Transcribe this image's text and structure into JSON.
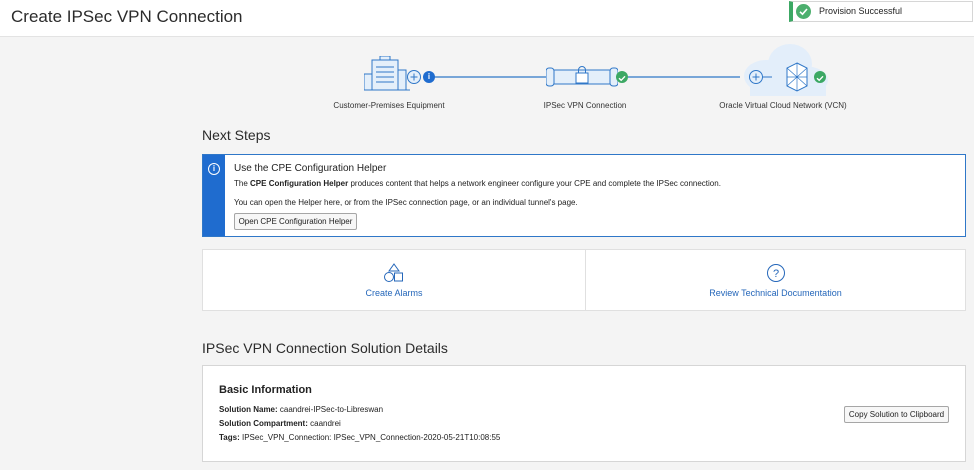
{
  "header": {
    "title": "Create IPSec VPN Connection"
  },
  "toast": {
    "message": "Provision Successful",
    "status_color": "#3ca864"
  },
  "diagram": {
    "steps": [
      {
        "label": "Customer-Premises Equipment",
        "status": "info",
        "status_color": "#1f6ccf",
        "icon": "building-icon"
      },
      {
        "label": "IPSec VPN Connection",
        "status": "success",
        "status_color": "#3ca864",
        "icon": "vpn-tunnel-icon"
      },
      {
        "label": "Oracle Virtual Cloud Network (VCN)",
        "status": "success",
        "status_color": "#3ca864",
        "icon": "cloud-network-icon"
      }
    ],
    "accent_color": "#2f77c8"
  },
  "next_steps": {
    "title": "Next Steps",
    "helper": {
      "title": "Use the CPE Configuration Helper",
      "desc_prefix": "The ",
      "desc_bold": "CPE Configuration Helper",
      "desc_suffix": " produces content that helps a network engineer configure your CPE and complete the IPSec connection.",
      "note": "You can open the Helper here, or from the IPSec connection page, or an individual tunnel's page.",
      "button_label": "Open CPE Configuration Helper"
    },
    "cards": [
      {
        "label": "Create Alarms",
        "icon": "shapes-icon"
      },
      {
        "label": "Review Technical Documentation",
        "icon": "question-icon"
      }
    ],
    "link_color": "#2567ba"
  },
  "details": {
    "title": "IPSec VPN Connection Solution Details",
    "heading": "Basic Information",
    "rows": [
      {
        "key": "Solution Name:",
        "value": " caandrei-IPSec-to-Libreswan"
      },
      {
        "key": "Solution Compartment:",
        "value": " caandrei"
      },
      {
        "key": "Tags:",
        "value": " IPSec_VPN_Connection: IPSec_VPN_Connection-2020-05-21T10:08:55"
      }
    ],
    "copy_button": "Copy Solution to Clipboard"
  }
}
